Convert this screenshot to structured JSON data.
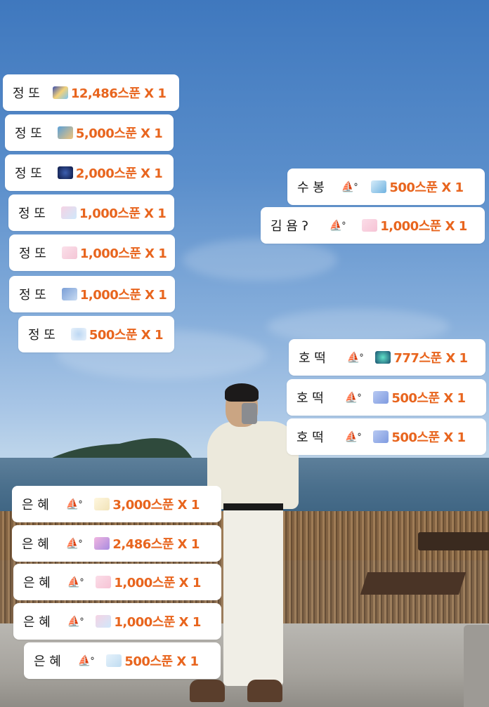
{
  "gifts_left_top": [
    {
      "name": "정 또",
      "badge": "",
      "amount": "12,486스푼 X 1"
    },
    {
      "name": "정 또",
      "badge": "",
      "amount": "5,000스푼 X 1"
    },
    {
      "name": "정 또",
      "badge": "",
      "amount": "2,000스푼 X 1"
    },
    {
      "name": "정 또",
      "badge": "",
      "amount": "1,000스푼 X 1"
    },
    {
      "name": "정 또",
      "badge": "",
      "amount": "1,000스푼 X 1"
    },
    {
      "name": "정 또",
      "badge": "",
      "amount": "1,000스푼 X 1"
    },
    {
      "name": "정 또",
      "badge": "",
      "amount": "500스푼 X 1"
    }
  ],
  "gifts_right_top": [
    {
      "name": "수 봉",
      "badge": "⛵ᐤ",
      "amount": "500스푼 X 1"
    },
    {
      "name": "김 욤 ʔ",
      "badge": "⛵ᐤ",
      "amount": "1,000스푼 X 1"
    }
  ],
  "gifts_right_mid": [
    {
      "name": "호 떡",
      "badge": "⛵ᐤ",
      "amount": "777스푼 X 1"
    },
    {
      "name": "호 떡",
      "badge": "⛵ᐤ",
      "amount": "500스푼 X 1"
    },
    {
      "name": "호 떡",
      "badge": "⛵ᐤ",
      "amount": "500스푼 X 1"
    }
  ],
  "gifts_left_bottom": [
    {
      "name": "은 혜",
      "badge": "⛵ᐤ",
      "amount": "3,000스푼 X 1"
    },
    {
      "name": "은 혜",
      "badge": "⛵ᐤ",
      "amount": "2,486스푼 X 1"
    },
    {
      "name": "은 혜",
      "badge": "⛵ᐤ",
      "amount": "1,000스푼 X 1"
    },
    {
      "name": "은 혜",
      "badge": "⛵ᐤ",
      "amount": "1,000스푼 X 1"
    },
    {
      "name": "은 혜",
      "badge": "⛵ᐤ",
      "amount": "500스푼 X 1"
    }
  ],
  "colors": {
    "amount": "#e8651e",
    "pill_bg": "#ffffff"
  }
}
